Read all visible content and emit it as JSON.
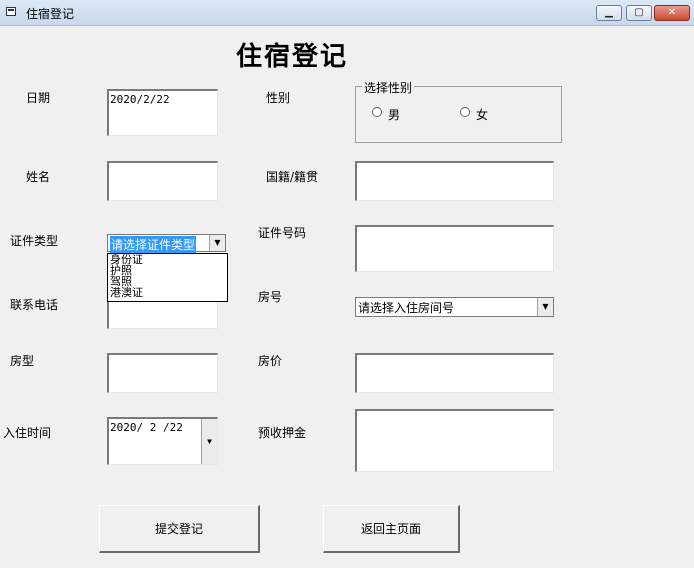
{
  "window": {
    "title": "住宿登记",
    "minimize_glyph": "▁",
    "maximize_glyph": "▢",
    "close_glyph": "✕"
  },
  "heading": "住宿登记",
  "labels": {
    "date": "日期",
    "gender": "性别",
    "name": "姓名",
    "nationality": "国籍/籍贯",
    "id_type": "证件类型",
    "id_number": "证件号码",
    "phone": "联系电话",
    "room_number": "房号",
    "room_type": "房型",
    "room_price": "房价",
    "checkin_time": "入住时间",
    "deposit": "预收押金"
  },
  "fields": {
    "date_value": "2020/2/22",
    "checkin_value": "2020/ 2 /22",
    "name_value": "",
    "nationality_value": "",
    "id_number_value": "",
    "phone_value": "",
    "room_type_value": "",
    "room_price_value": "",
    "deposit_value": ""
  },
  "gender_group": {
    "legend": "选择性别",
    "options": [
      "男",
      "女"
    ]
  },
  "id_type_combo": {
    "selected": "请选择证件类型",
    "options": [
      "身份证",
      "护照",
      "驾照",
      "港澳证"
    ]
  },
  "room_combo": {
    "selected": "请选择入住房间号"
  },
  "buttons": {
    "submit": "提交登记",
    "back": "返回主页面"
  }
}
